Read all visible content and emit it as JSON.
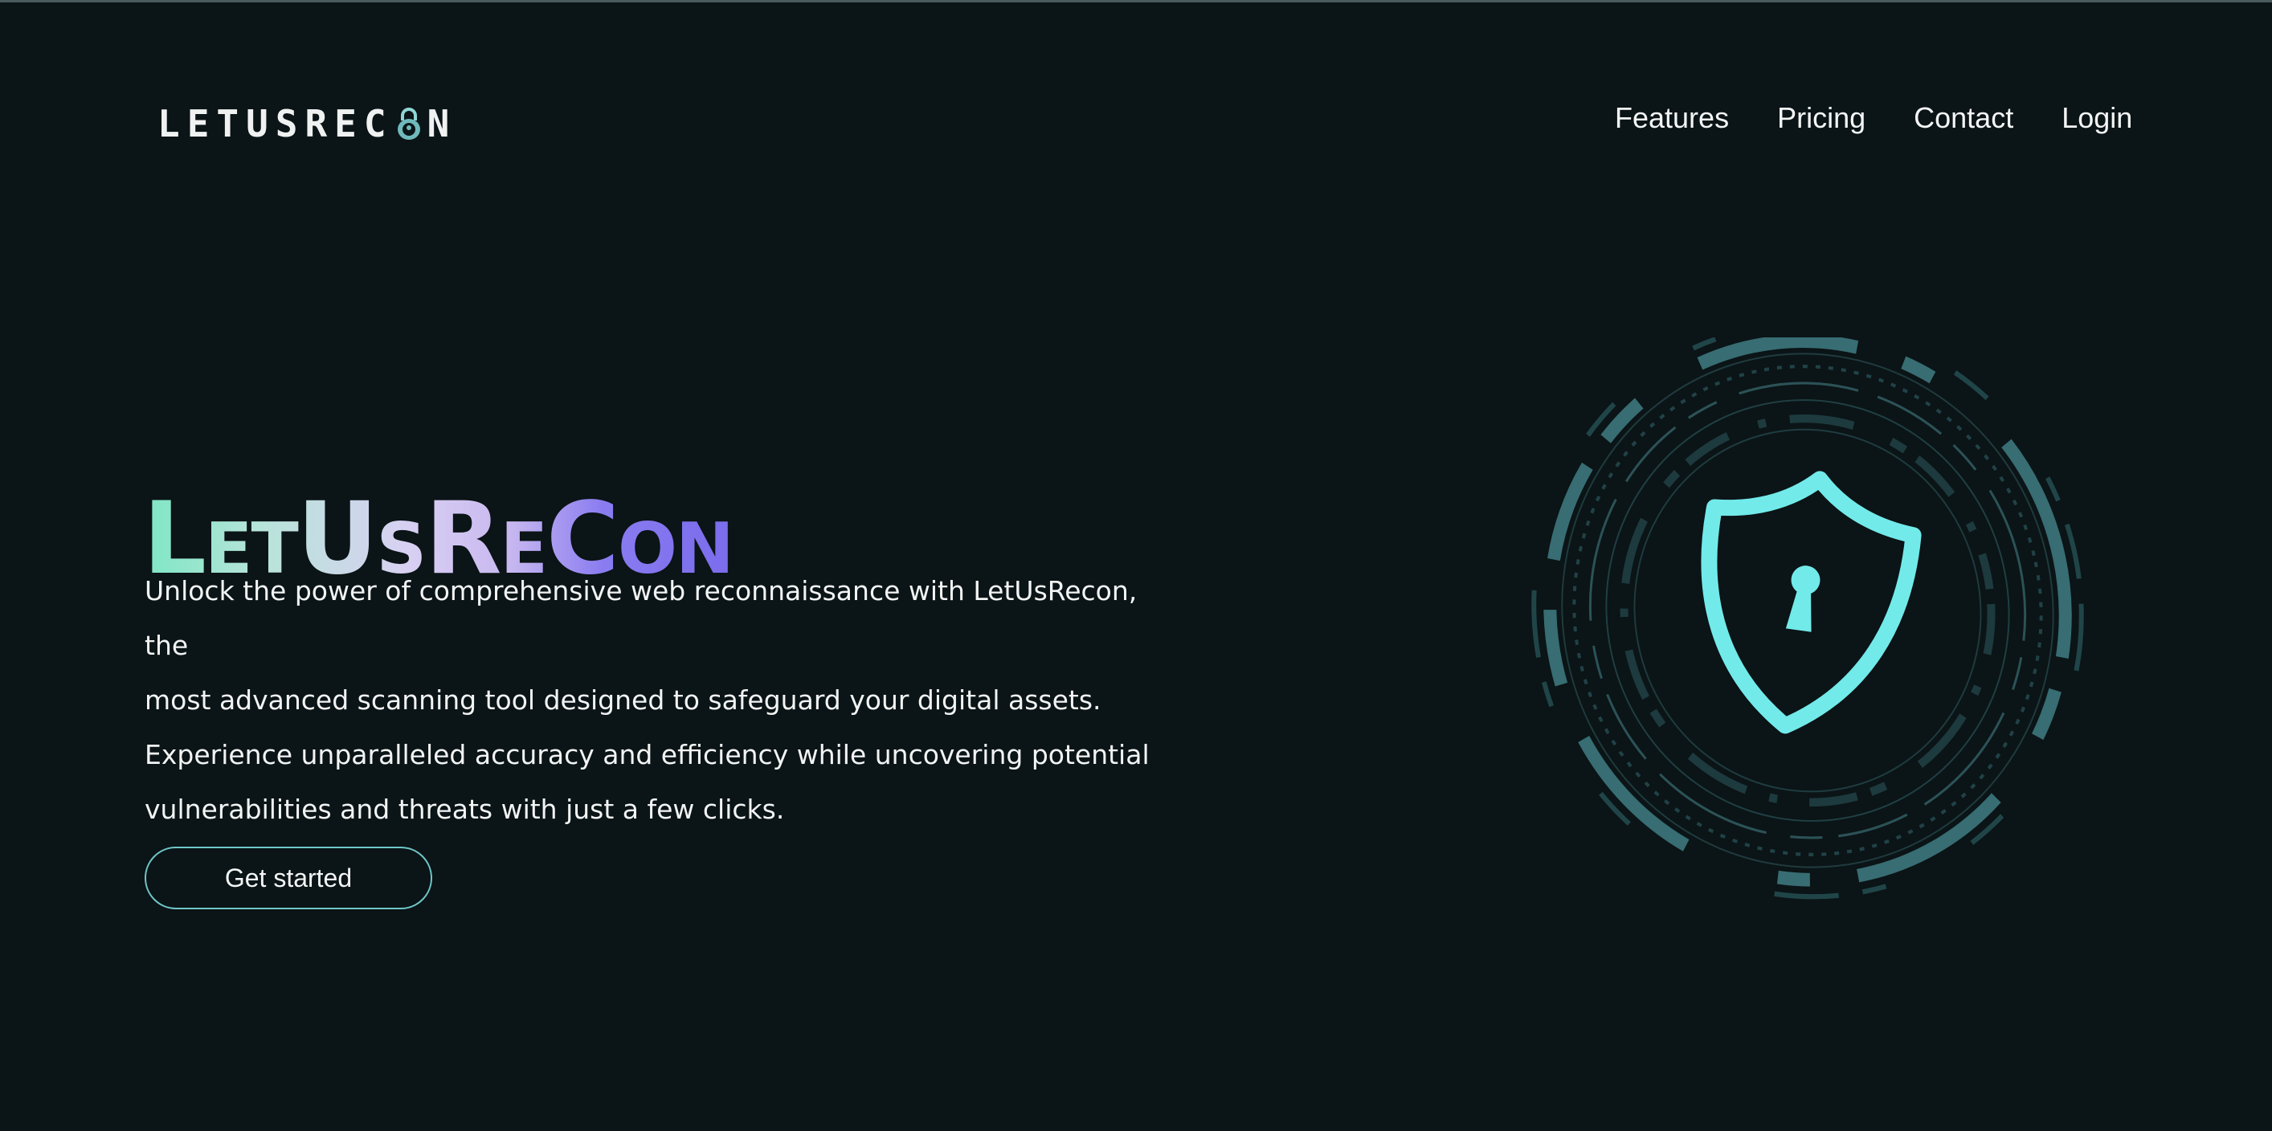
{
  "header": {
    "logo_text_left": "LETUSREC",
    "logo_text_right": "N",
    "nav": {
      "features": "Features",
      "pricing": "Pricing",
      "contact": "Contact",
      "login": "Login"
    }
  },
  "hero": {
    "title": "LetUsReCon",
    "description_lines": [
      "Unlock the power of comprehensive web reconnaissance with LetUsRecon, the",
      "most advanced scanning tool designed to safeguard your digital assets.",
      "Experience unparalleled accuracy and efficiency while uncovering potential",
      "vulnerabilities and threats with just a few clicks."
    ],
    "cta_label": "Get started"
  },
  "icons": {
    "logo_lock": "padlock-icon",
    "hero": "shield-keyhole-icon"
  },
  "colors": {
    "background": "#0b1416",
    "accent": "#6fe8e8",
    "button_border": "#6fc7c9"
  }
}
